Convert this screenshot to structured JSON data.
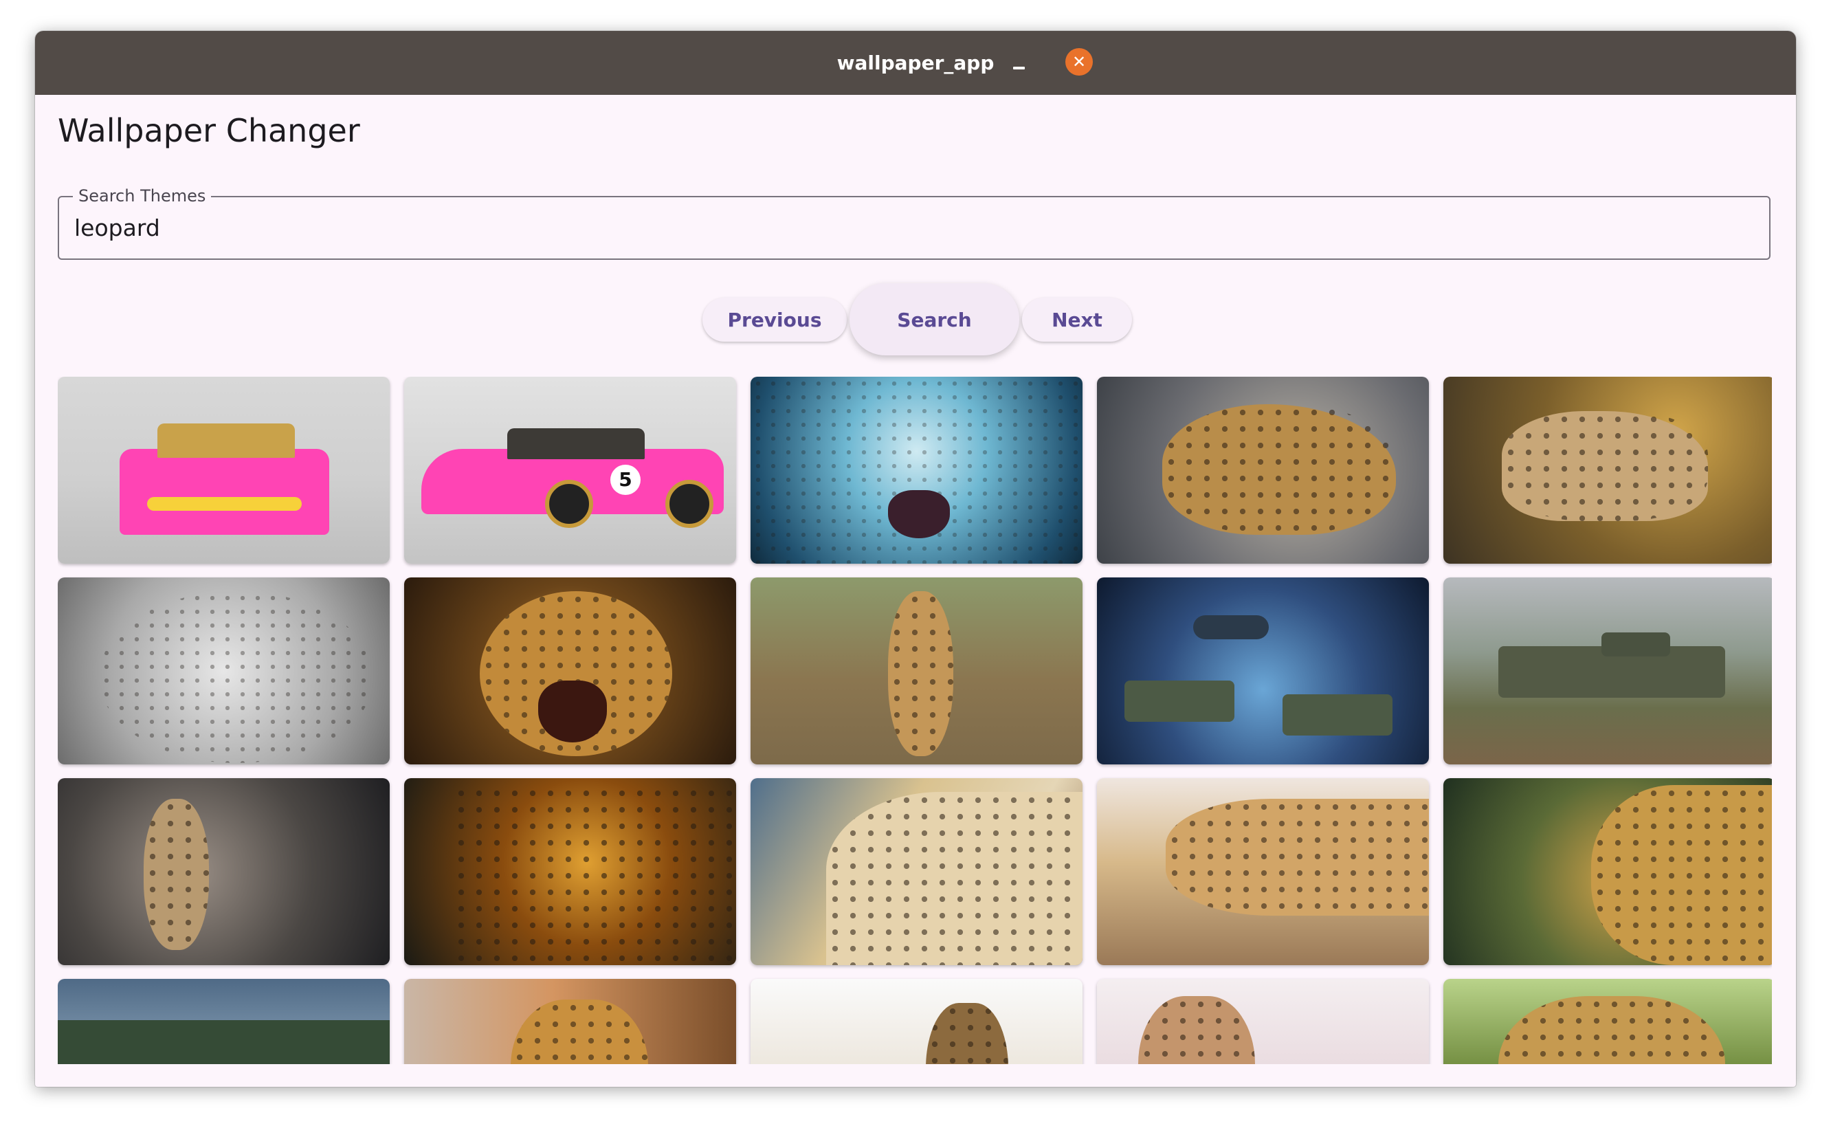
{
  "window": {
    "title": "wallpaper_app",
    "minimize_icon": "minimize-icon",
    "close_icon": "close-icon",
    "close_glyph": "✕"
  },
  "header": {
    "title": "Wallpaper Changer"
  },
  "search": {
    "label": "Search Themes",
    "value": "leopard"
  },
  "buttons": {
    "previous": "Previous",
    "search": "Search",
    "next": "Next"
  },
  "wallpapers": [
    {
      "subject": "pink rally car front"
    },
    {
      "subject": "pink rally car side"
    },
    {
      "subject": "snow leopard lightning"
    },
    {
      "subject": "leopard walking in snow"
    },
    {
      "subject": "leopard standing in forest"
    },
    {
      "subject": "snow leopard close-up"
    },
    {
      "subject": "roaring leopard"
    },
    {
      "subject": "leopard walking on savanna"
    },
    {
      "subject": "tanks and helicopters battle"
    },
    {
      "subject": "leopard tank in field"
    },
    {
      "subject": "leopard walking in mist"
    },
    {
      "subject": "fractal glowing leopard"
    },
    {
      "subject": "leopard face on branch"
    },
    {
      "subject": "leopard lying on log"
    },
    {
      "subject": "leopard portrait in forest"
    },
    {
      "subject": "landscape with hills"
    },
    {
      "subject": "hand petting leopard cub"
    },
    {
      "subject": "leopard on tree branch"
    },
    {
      "subject": "leopard cub standing"
    },
    {
      "subject": "leopard in grass"
    }
  ]
}
